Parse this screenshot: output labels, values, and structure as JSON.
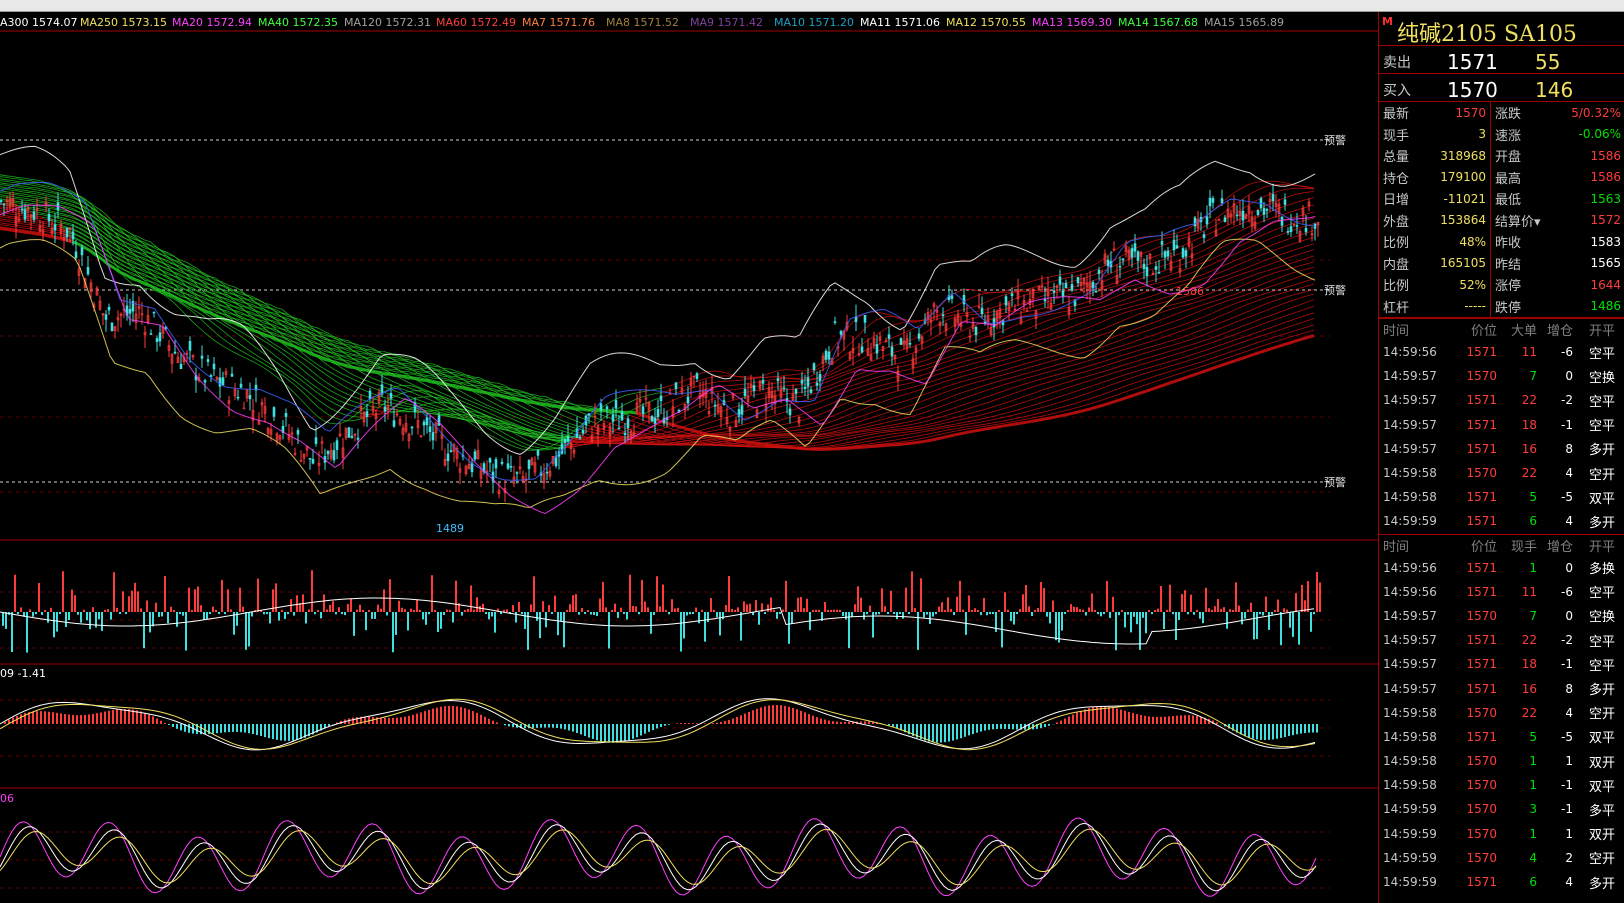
{
  "header": {
    "marker": "M",
    "title": "纯碱2105  SA105"
  },
  "quote": {
    "sell": {
      "label": "卖出",
      "price": "1571",
      "volume": "55"
    },
    "buy": {
      "label": "买入",
      "price": "1570",
      "volume": "146"
    }
  },
  "stats": [
    {
      "k": "最新",
      "v": "1570",
      "c": "red",
      "k2": "涨跌",
      "v2": "5/0.32%",
      "c2": "red"
    },
    {
      "k": "现手",
      "v": "3",
      "c": "yel",
      "k2": "速涨",
      "v2": "-0.06%",
      "c2": "grn"
    },
    {
      "k": "总量",
      "v": "318968",
      "c": "yel",
      "k2": "开盘",
      "v2": "1586",
      "c2": "red"
    },
    {
      "k": "持仓",
      "v": "179100",
      "c": "yel",
      "k2": "最高",
      "v2": "1586",
      "c2": "red"
    },
    {
      "k": "日增",
      "v": "-11021",
      "c": "yel",
      "k2": "最低",
      "v2": "1563",
      "c2": "grn"
    },
    {
      "k": "外盘",
      "v": "153864",
      "c": "yel",
      "k2": "结算价",
      "v2": "1572",
      "c2": "red"
    },
    {
      "k": "比例",
      "v": "48%",
      "c": "yel",
      "k2": "昨收",
      "v2": "1583",
      "c2": "wht"
    },
    {
      "k": "内盘",
      "v": "165105",
      "c": "yel",
      "k2": "昨结",
      "v2": "1565",
      "c2": "wht"
    },
    {
      "k": "比例",
      "v": "52%",
      "c": "yel",
      "k2": "涨停",
      "v2": "1644",
      "c2": "red"
    },
    {
      "k": "杠杆",
      "v": "-----",
      "c": "yel",
      "k2": "跌停",
      "v2": "1486",
      "c2": "grn"
    }
  ],
  "big_orders": {
    "headers": [
      "时间",
      "价位",
      "大单",
      "增仓",
      "开平"
    ],
    "rows": [
      [
        "14:59:56",
        "1571",
        "11",
        "-6",
        "空平"
      ],
      [
        "14:59:57",
        "1570",
        "7",
        "0",
        "空换"
      ],
      [
        "14:59:57",
        "1571",
        "22",
        "-2",
        "空平"
      ],
      [
        "14:59:57",
        "1571",
        "18",
        "-1",
        "空平"
      ],
      [
        "14:59:57",
        "1571",
        "16",
        "8",
        "多开"
      ],
      [
        "14:59:58",
        "1570",
        "22",
        "4",
        "空开"
      ],
      [
        "14:59:58",
        "1571",
        "5",
        "-5",
        "双平"
      ],
      [
        "14:59:59",
        "1571",
        "6",
        "4",
        "多开"
      ]
    ]
  },
  "ticks": {
    "headers": [
      "时间",
      "价位",
      "现手",
      "增仓",
      "开平"
    ],
    "rows": [
      [
        "14:59:56",
        "1571",
        "1",
        "0",
        "多换"
      ],
      [
        "14:59:56",
        "1571",
        "11",
        "-6",
        "空平"
      ],
      [
        "14:59:57",
        "1570",
        "7",
        "0",
        "空换"
      ],
      [
        "14:59:57",
        "1571",
        "22",
        "-2",
        "空平"
      ],
      [
        "14:59:57",
        "1571",
        "18",
        "-1",
        "空平"
      ],
      [
        "14:59:57",
        "1571",
        "16",
        "8",
        "多开"
      ],
      [
        "14:59:58",
        "1570",
        "22",
        "4",
        "空开"
      ],
      [
        "14:59:58",
        "1571",
        "5",
        "-5",
        "双平"
      ],
      [
        "14:59:58",
        "1570",
        "1",
        "1",
        "双开"
      ],
      [
        "14:59:58",
        "1570",
        "1",
        "-1",
        "双平"
      ],
      [
        "14:59:59",
        "1570",
        "3",
        "-1",
        "多平"
      ],
      [
        "14:59:59",
        "1570",
        "1",
        "1",
        "双开"
      ],
      [
        "14:59:59",
        "1570",
        "4",
        "2",
        "空开"
      ],
      [
        "14:59:59",
        "1571",
        "6",
        "4",
        "多开"
      ]
    ]
  },
  "ma_legend": [
    {
      "label": "A300 1574.07",
      "color": "#ffffff"
    },
    {
      "label": "MA250 1573.15",
      "color": "#f0e060"
    },
    {
      "label": "MA20 1572.94",
      "color": "#ff40ff"
    },
    {
      "label": "MA40 1572.35",
      "color": "#40ff40"
    },
    {
      "label": "MA120 1572.31",
      "color": "#a0a0a0"
    },
    {
      "label": "MA60 1572.49",
      "color": "#ff4040"
    },
    {
      "label": "MA7 1571.76",
      "color": "#ff8040"
    },
    {
      "label": "MA8 1571.52",
      "color": "#a08040"
    },
    {
      "label": "MA9 1571.42",
      "color": "#8040a0"
    },
    {
      "label": "MA10 1571.20",
      "color": "#20a0c0"
    },
    {
      "label": "MA11 1571.06",
      "color": "#ffffff"
    },
    {
      "label": "MA12 1570.55",
      "color": "#f0e060"
    },
    {
      "label": "MA13 1569.30",
      "color": "#ff40ff"
    },
    {
      "label": "MA14 1567.68",
      "color": "#40ff40"
    },
    {
      "label": "MA15 1565.89",
      "color": "#a0a0a0"
    }
  ],
  "chart_labels": {
    "alert": "预警",
    "high": "1586",
    "low": "1489",
    "macd_vals": "09   -1.41",
    "kdj_val": "06"
  },
  "chart_data": [
    {
      "type": "candlestick",
      "high": 1586,
      "low": 1489,
      "price": [
        1575,
        1572,
        1566,
        1540,
        1542,
        1530,
        1522,
        1518,
        1509,
        1497,
        1506,
        1514,
        1508,
        1500,
        1494,
        1491,
        1498,
        1508,
        1510,
        1512,
        1518,
        1512,
        1518,
        1514,
        1534,
        1534,
        1528,
        1543,
        1538,
        1543,
        1545,
        1547,
        1557,
        1556,
        1560,
        1571,
        1574,
        1571,
        1570
      ],
      "ylim": [
        1480,
        1600
      ]
    },
    {
      "type": "bar",
      "name": "volume"
    },
    {
      "type": "bar",
      "name": "MACD"
    },
    {
      "type": "line",
      "name": "KDJ"
    }
  ]
}
